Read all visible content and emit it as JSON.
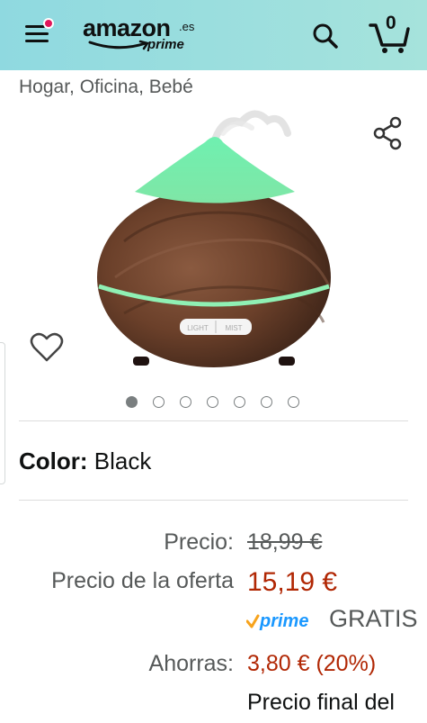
{
  "header": {
    "logo_text": "amazon",
    "logo_tld": ".es",
    "logo_prime": "prime",
    "cart_count": "0",
    "colors": {
      "bar": "#a6e3dc",
      "notification": "#e2165a"
    }
  },
  "breadcrumb": "Hogar, Oficina, Bebé",
  "product": {
    "image_label_left": "LIGHT",
    "image_label_right": "MIST",
    "carousel": {
      "total": 7,
      "active": 1
    }
  },
  "color": {
    "label": "Color:",
    "value": "Black"
  },
  "pricing": {
    "list_label": "Precio:",
    "list_value": "18,99 €",
    "deal_label": "Precio de la oferta",
    "deal_value": "15,19 €",
    "prime_badge": "prime",
    "shipping": "GRATIS",
    "savings_label": "Ahorras:",
    "savings_value": "3,80 € (20%)",
    "final_label": "Precio final del",
    "colors": {
      "deal": "#b12704",
      "prime": "#1a98ff",
      "check": "#f7a31c"
    }
  },
  "icons": [
    "menu-icon",
    "search-icon",
    "cart-icon",
    "share-icon",
    "heart-icon"
  ]
}
